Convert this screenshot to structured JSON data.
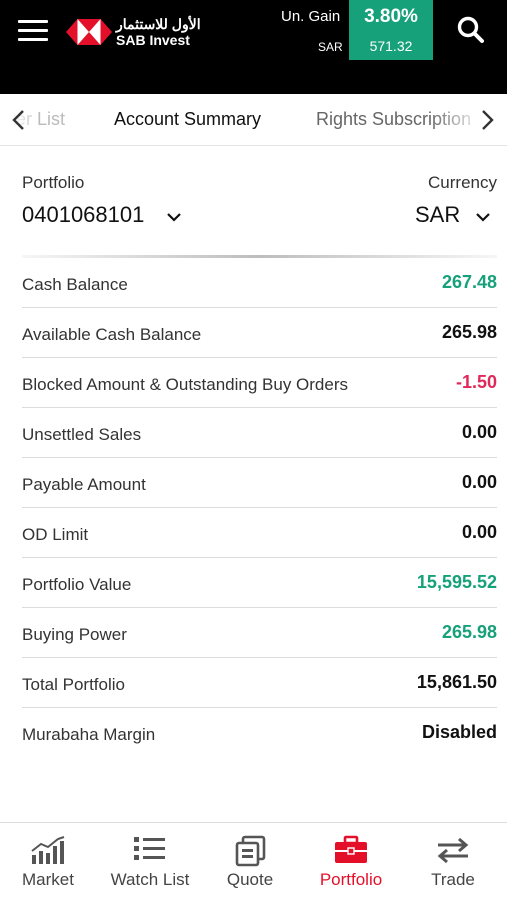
{
  "header": {
    "menu_icon": "hamburger-menu-icon",
    "logo_ar": "الأول للاستثمار",
    "logo_en": "SAB Invest",
    "gain_label": "Un. Gain",
    "gain_currency": "SAR",
    "gain_percent": "3.80%",
    "gain_value": "571.32",
    "gain_color": "#17a17a",
    "search_icon": "search-icon"
  },
  "tabs": {
    "prev_label": "der List",
    "active_label": "Account Summary",
    "next_label": "Rights Subscription",
    "left_arrow_icon": "chevron-left-icon",
    "right_arrow_icon": "chevron-right-icon"
  },
  "account": {
    "portfolio_label": "Portfolio",
    "portfolio_value": "0401068101",
    "currency_label": "Currency",
    "currency_value": "SAR"
  },
  "rows": [
    {
      "label": "Cash Balance",
      "value": "267.48",
      "tone": "positive"
    },
    {
      "label": "Available Cash Balance",
      "value": "265.98",
      "tone": "neutral"
    },
    {
      "label": "Blocked Amount & Outstanding Buy Orders",
      "value": "-1.50",
      "tone": "negative"
    },
    {
      "label": "Unsettled Sales",
      "value": "0.00",
      "tone": "neutral"
    },
    {
      "label": "Payable Amount",
      "value": "0.00",
      "tone": "neutral"
    },
    {
      "label": "OD Limit",
      "value": "0.00",
      "tone": "neutral"
    },
    {
      "label": "Portfolio Value",
      "value": "15,595.52",
      "tone": "positive"
    },
    {
      "label": "Buying Power",
      "value": "265.98",
      "tone": "positive"
    },
    {
      "label": "Total Portfolio",
      "value": "15,861.50",
      "tone": "neutral"
    },
    {
      "label": "Murabaha Margin",
      "value": "Disabled",
      "tone": "neutral"
    }
  ],
  "colors": {
    "positive": "#17a17a",
    "negative": "#e0285a",
    "active_nav": "#e4102a"
  },
  "bottom_nav": [
    {
      "label": "Market",
      "icon": "market-chart-icon",
      "active": false
    },
    {
      "label": "Watch List",
      "icon": "watch-list-icon",
      "active": false
    },
    {
      "label": "Quote",
      "icon": "quote-icon",
      "active": false
    },
    {
      "label": "Portfolio",
      "icon": "portfolio-briefcase-icon",
      "active": true
    },
    {
      "label": "Trade",
      "icon": "trade-arrows-icon",
      "active": false
    }
  ]
}
